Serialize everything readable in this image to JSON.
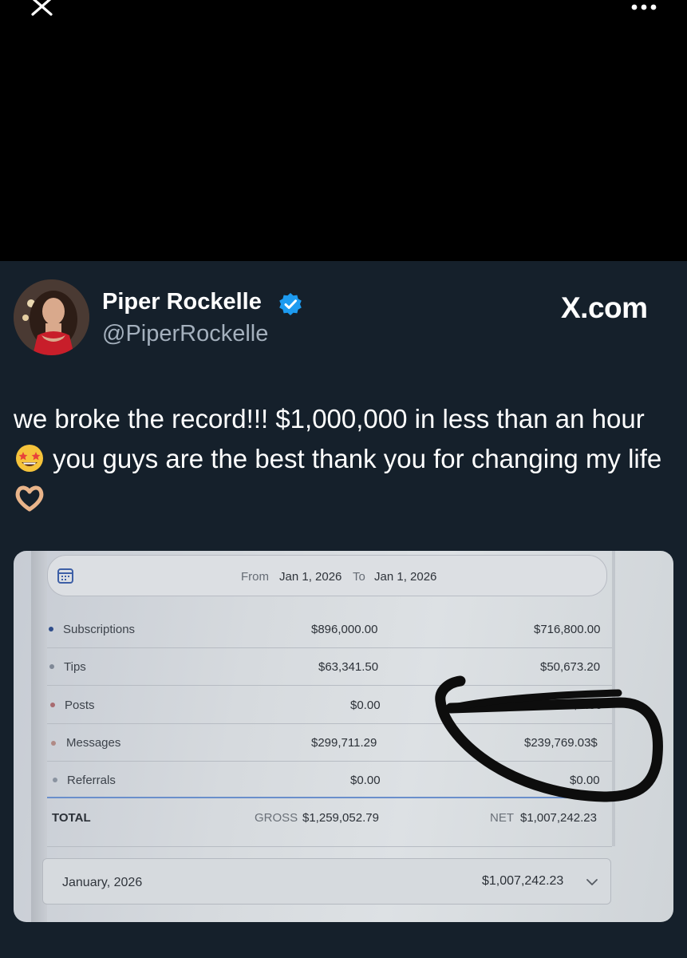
{
  "header": {
    "close_icon": "close-icon",
    "more_icon": "more-dots-icon"
  },
  "post": {
    "author_name": "Piper Rockelle",
    "verified_color": "#1d9bf0",
    "handle": "@PiperRockelle",
    "brand": "X.com",
    "text_part1": "we broke the record!!! $1,000,000 in less than an hour",
    "emoji1": "star-struck-emoji",
    "text_part2": "you guys are the best thank you for changing my life",
    "emoji2": "heart-hands-emoji"
  },
  "earnings": {
    "from_label": "From",
    "from_date": "Jan 1, 2026",
    "to_label": "To",
    "to_date": "Jan 1, 2026",
    "rows": [
      {
        "label": "Subscriptions",
        "gross": "$896,000.00",
        "net": "$716,800.00",
        "dot_color": "#2f4d8a"
      },
      {
        "label": "Tips",
        "gross": "$63,341.50",
        "net": "$50,673.20",
        "dot_color": "#7f8896"
      },
      {
        "label": "Posts",
        "gross": "$0.00",
        "net": "$0.00",
        "dot_color": "#a86b70"
      },
      {
        "label": "Messages",
        "gross": "$299,711.29",
        "net": "$239,769.03$",
        "dot_color": "#b08a86"
      },
      {
        "label": "Referrals",
        "gross": "$0.00",
        "net": "$0.00",
        "dot_color": "#8a93a0"
      }
    ],
    "total_label": "TOTAL",
    "gross_label": "GROSS",
    "gross_total": "$1,259,052.79",
    "net_label": "NET",
    "net_total": "$1,007,242.23",
    "month_label": "January, 2026",
    "month_value": "$1,007,242.23"
  }
}
